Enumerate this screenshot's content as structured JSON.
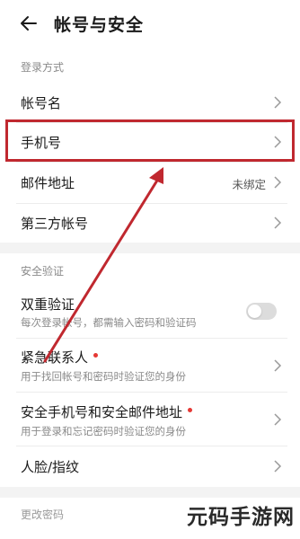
{
  "header": {
    "title": "帐号与安全"
  },
  "login_section": {
    "label": "登录方式",
    "items": [
      {
        "label": "帐号名",
        "value": ""
      },
      {
        "label": "手机号",
        "value": ""
      },
      {
        "label": "邮件地址",
        "value": "未绑定"
      },
      {
        "label": "第三方帐号",
        "value": ""
      }
    ]
  },
  "security_section": {
    "label": "安全验证",
    "two_factor": {
      "label": "双重验证",
      "subtitle": "每次登录帐号，都需输入密码和验证码",
      "enabled": false
    },
    "emergency": {
      "label": "紧急联系人",
      "subtitle": "用于找回帐号和密码时验证您的身份"
    },
    "secure_phone_email": {
      "label": "安全手机号和安全邮件地址",
      "subtitle": "用于登录和忘记密码时验证您的身份"
    },
    "face": {
      "label": "人脸/指纹"
    }
  },
  "password": {
    "label": "更改密码"
  },
  "watermark": {
    "text": "元码手游网"
  },
  "colors": {
    "highlight": "#c0282f",
    "accent_dot": "#e53935"
  }
}
